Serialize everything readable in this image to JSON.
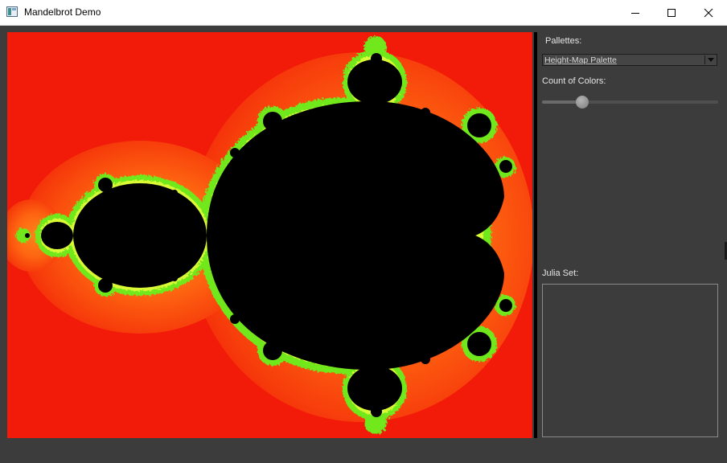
{
  "window": {
    "title": "Mandelbrot Demo",
    "icon": "app-window-icon",
    "controls": [
      "minimize-icon",
      "maximize-icon",
      "close-icon"
    ]
  },
  "fractal": {
    "name": "mandelbrot-set",
    "background_color": "#f21a08",
    "set_color": "#000000",
    "edge_colors": [
      "#7cfc00",
      "#ffff33"
    ]
  },
  "panel": {
    "pallettes_label": "Pallettes:",
    "palette_selected": "Height-Map Palette",
    "count_label": "Count of Colors:",
    "count_slider_level": 0.23,
    "julia_label": "Julia Set:"
  }
}
